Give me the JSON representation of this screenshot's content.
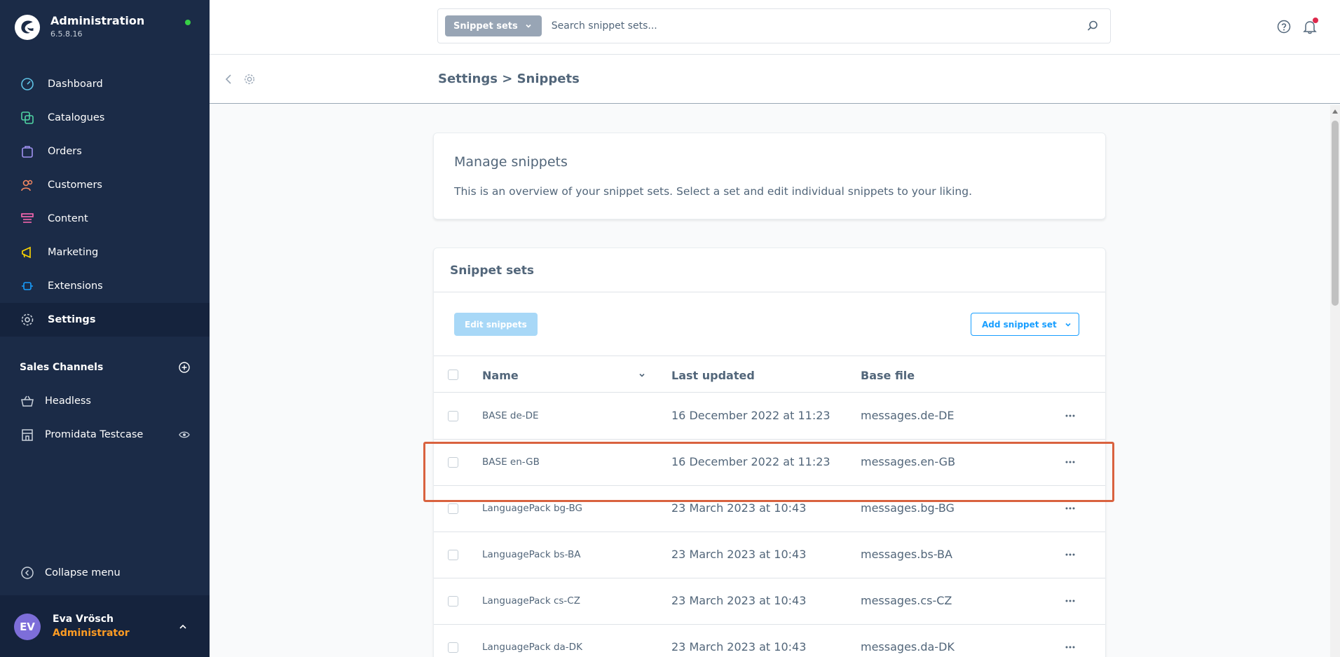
{
  "app": {
    "title": "Administration",
    "version": "6.5.8.16"
  },
  "sidebar": {
    "items": [
      {
        "label": "Dashboard",
        "icon": "dashboard-icon"
      },
      {
        "label": "Catalogues",
        "icon": "catalogue-icon"
      },
      {
        "label": "Orders",
        "icon": "orders-icon"
      },
      {
        "label": "Customers",
        "icon": "customers-icon"
      },
      {
        "label": "Content",
        "icon": "content-icon"
      },
      {
        "label": "Marketing",
        "icon": "marketing-icon"
      },
      {
        "label": "Extensions",
        "icon": "extensions-icon"
      },
      {
        "label": "Settings",
        "icon": "gear-icon",
        "active": true
      }
    ],
    "sales_channels_title": "Sales Channels",
    "sales_channels": [
      {
        "label": "Headless",
        "icon": "basket-icon"
      },
      {
        "label": "Promidata Testcase",
        "icon": "storefront-icon"
      }
    ],
    "collapse_label": "Collapse menu"
  },
  "user": {
    "initials": "EV",
    "name": "Eva Vrösch",
    "role": "Administrator"
  },
  "search": {
    "type_label": "Snippet sets",
    "placeholder": "Search snippet sets..."
  },
  "header": {
    "breadcrumb": "Settings > Snippets"
  },
  "manage": {
    "title": "Manage snippets",
    "description": "This is an overview of your snippet sets. Select a set and edit individual snippets to your liking."
  },
  "snippet_sets": {
    "title": "Snippet sets",
    "edit_button": "Edit snippets",
    "add_button": "Add snippet set",
    "columns": {
      "name": "Name",
      "updated": "Last updated",
      "file": "Base file"
    },
    "rows": [
      {
        "name": "BASE de-DE",
        "updated": "16 December 2022 at 11:23",
        "file": "messages.de-DE"
      },
      {
        "name": "BASE en-GB",
        "updated": "16 December 2022 at 11:23",
        "file": "messages.en-GB"
      },
      {
        "name": "LanguagePack bg-BG",
        "updated": "23 March 2023 at 10:43",
        "file": "messages.bg-BG"
      },
      {
        "name": "LanguagePack bs-BA",
        "updated": "23 March 2023 at 10:43",
        "file": "messages.bs-BA"
      },
      {
        "name": "LanguagePack cs-CZ",
        "updated": "23 March 2023 at 10:43",
        "file": "messages.cs-CZ"
      },
      {
        "name": "LanguagePack da-DK",
        "updated": "23 March 2023 at 10:43",
        "file": "messages.da-DK"
      }
    ]
  },
  "colors": {
    "sidebar_bg": "#1b2b47",
    "accent": "#189eff",
    "highlight": "#d9623f",
    "role": "#ff9c23",
    "status_online": "#37d046"
  }
}
